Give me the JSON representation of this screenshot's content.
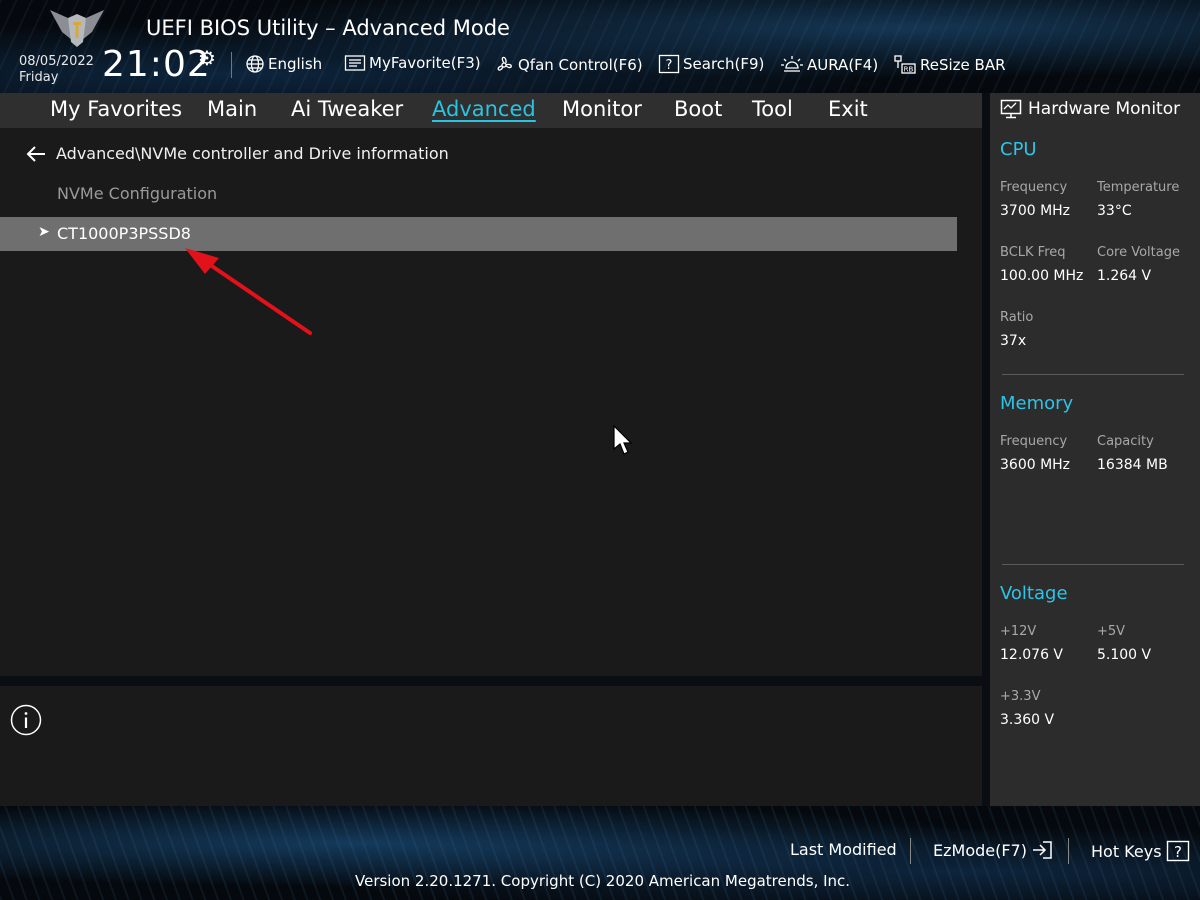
{
  "header": {
    "title": "UEFI BIOS Utility – Advanced Mode",
    "date": "08/05/2022",
    "day": "Friday",
    "time": "21:02",
    "toolbar": [
      {
        "label": "English",
        "icon": "globe-icon"
      },
      {
        "label": "MyFavorite(F3)",
        "icon": "favorite-list-icon"
      },
      {
        "label": "Qfan Control(F6)",
        "icon": "fan-icon"
      },
      {
        "label": "Search(F9)",
        "icon": "search-help-icon"
      },
      {
        "label": "AURA(F4)",
        "icon": "aura-light-icon"
      },
      {
        "label": "ReSize BAR",
        "icon": "resize-bar-icon"
      }
    ]
  },
  "menu": {
    "items": [
      {
        "label": "My Favorites"
      },
      {
        "label": "Main"
      },
      {
        "label": "Ai Tweaker"
      },
      {
        "label": "Advanced",
        "active": true
      },
      {
        "label": "Monitor"
      },
      {
        "label": "Boot"
      },
      {
        "label": "Tool"
      },
      {
        "label": "Exit"
      }
    ]
  },
  "content": {
    "breadcrumb": "Advanced\\NVMe controller and Drive information",
    "section_title": "NVMe Configuration",
    "drive_item": "CT1000P3PSSD8",
    "annotation_color": "#e3111a"
  },
  "hardware_monitor": {
    "title": "Hardware Monitor",
    "accent": "#2ec4e6",
    "cpu": {
      "title": "CPU",
      "frequency_label": "Frequency",
      "frequency": "3700 MHz",
      "temperature_label": "Temperature",
      "temperature": "33°C",
      "bclk_label": "BCLK Freq",
      "bclk": "100.00 MHz",
      "core_voltage_label": "Core Voltage",
      "core_voltage": "1.264 V",
      "ratio_label": "Ratio",
      "ratio": "37x"
    },
    "memory": {
      "title": "Memory",
      "frequency_label": "Frequency",
      "frequency": "3600 MHz",
      "capacity_label": "Capacity",
      "capacity": "16384 MB"
    },
    "voltage": {
      "title": "Voltage",
      "v12_label": "+12V",
      "v12": "12.076 V",
      "v5_label": "+5V",
      "v5": "5.100 V",
      "v33_label": "+3.3V",
      "v33": "3.360 V"
    }
  },
  "footer": {
    "last_modified": "Last Modified",
    "ezmode": "EzMode(F7)",
    "hotkeys": "Hot Keys",
    "copyright": "Version 2.20.1271. Copyright (C) 2020 American Megatrends, Inc."
  }
}
